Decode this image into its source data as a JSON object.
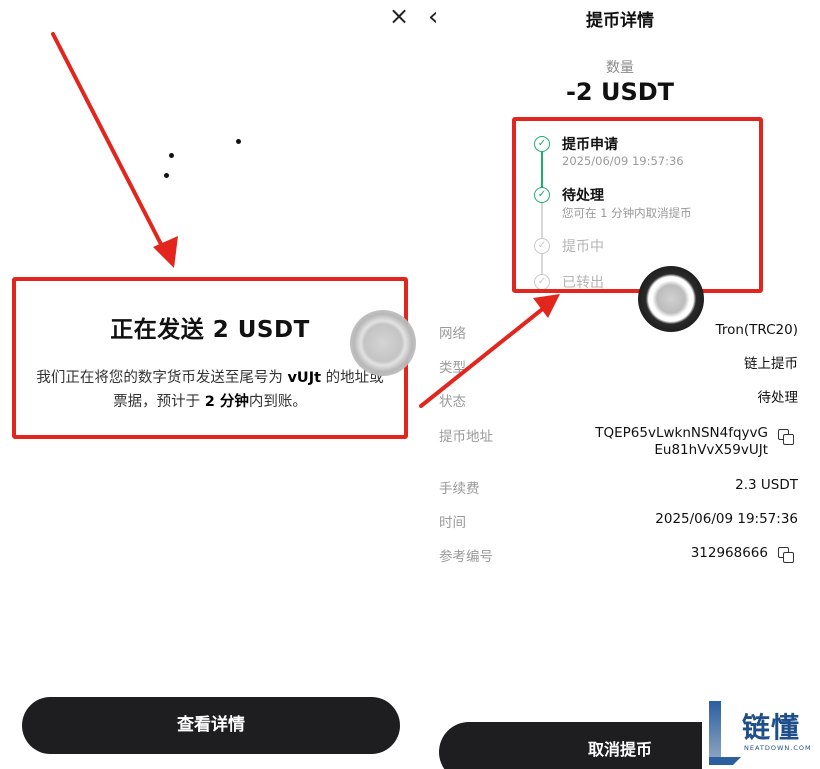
{
  "left": {
    "close_icon": "×",
    "title": "正在发送 2 USDT",
    "desc_part1": "我们正在将您的数字货币发送至尾号为 ",
    "desc_bold1": "vUJt",
    "desc_part2": " 的地址或票据，预计于 ",
    "desc_bold2": "2 分钟",
    "desc_part3": "内到账。",
    "button_label": "查看详情"
  },
  "right": {
    "back_icon": "‹",
    "title": "提币详情",
    "amount_label": "数量",
    "amount_value": "-2 USDT",
    "steps": [
      {
        "title": "提币申请",
        "sub": "2025/06/09 19:57:36",
        "done": true
      },
      {
        "title": "待处理",
        "sub": "您可在 1 分钟内取消提币",
        "done": true
      },
      {
        "title": "提币中",
        "sub": "",
        "done": false
      },
      {
        "title": "已转出",
        "sub": "",
        "done": false
      }
    ],
    "info": {
      "network_label": "网络",
      "network_value": "Tron(TRC20)",
      "type_label": "类型",
      "type_value": "链上提币",
      "status_label": "状态",
      "status_value": "待处理",
      "address_label": "提币地址",
      "address_line1": "TQEP65vLwknNSN4fqyvG",
      "address_line2": "Eu81hVvX59vUJt",
      "fee_label": "手续费",
      "fee_value": "2.3 USDT",
      "time_label": "时间",
      "time_value": "2025/06/09 19:57:36",
      "ref_label": "参考编号",
      "ref_value": "312968666"
    },
    "button_label": "取消提币"
  },
  "watermark": {
    "text": "链懂",
    "sub": "NEATDOWN.COM"
  },
  "colors": {
    "annotation_red": "#e3261d",
    "success_green": "#19b06b",
    "button_dark": "#1e1e20",
    "watermark_blue": "#1f4f8a"
  },
  "icons": {
    "close": "close-icon",
    "back": "back-arrow-icon",
    "copy": "copy-icon",
    "check": "check-circle-icon"
  }
}
